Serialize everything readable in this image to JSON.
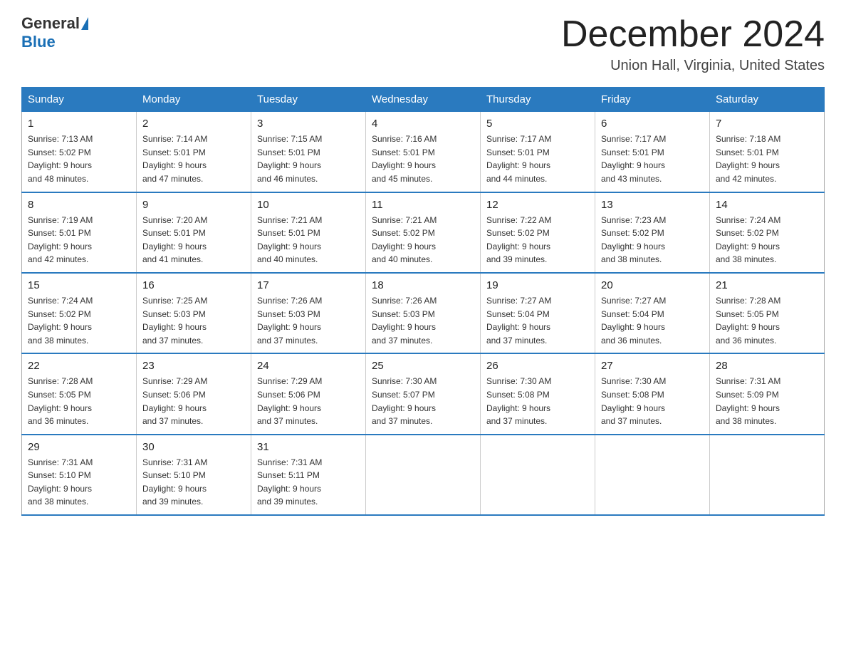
{
  "header": {
    "logo_general": "General",
    "logo_blue": "Blue",
    "month_title": "December 2024",
    "location": "Union Hall, Virginia, United States"
  },
  "days_of_week": [
    "Sunday",
    "Monday",
    "Tuesday",
    "Wednesday",
    "Thursday",
    "Friday",
    "Saturday"
  ],
  "weeks": [
    [
      {
        "day": "1",
        "sunrise": "7:13 AM",
        "sunset": "5:02 PM",
        "daylight_h": "9",
        "daylight_m": "48"
      },
      {
        "day": "2",
        "sunrise": "7:14 AM",
        "sunset": "5:01 PM",
        "daylight_h": "9",
        "daylight_m": "47"
      },
      {
        "day": "3",
        "sunrise": "7:15 AM",
        "sunset": "5:01 PM",
        "daylight_h": "9",
        "daylight_m": "46"
      },
      {
        "day": "4",
        "sunrise": "7:16 AM",
        "sunset": "5:01 PM",
        "daylight_h": "9",
        "daylight_m": "45"
      },
      {
        "day": "5",
        "sunrise": "7:17 AM",
        "sunset": "5:01 PM",
        "daylight_h": "9",
        "daylight_m": "44"
      },
      {
        "day": "6",
        "sunrise": "7:17 AM",
        "sunset": "5:01 PM",
        "daylight_h": "9",
        "daylight_m": "43"
      },
      {
        "day": "7",
        "sunrise": "7:18 AM",
        "sunset": "5:01 PM",
        "daylight_h": "9",
        "daylight_m": "42"
      }
    ],
    [
      {
        "day": "8",
        "sunrise": "7:19 AM",
        "sunset": "5:01 PM",
        "daylight_h": "9",
        "daylight_m": "42"
      },
      {
        "day": "9",
        "sunrise": "7:20 AM",
        "sunset": "5:01 PM",
        "daylight_h": "9",
        "daylight_m": "41"
      },
      {
        "day": "10",
        "sunrise": "7:21 AM",
        "sunset": "5:01 PM",
        "daylight_h": "9",
        "daylight_m": "40"
      },
      {
        "day": "11",
        "sunrise": "7:21 AM",
        "sunset": "5:02 PM",
        "daylight_h": "9",
        "daylight_m": "40"
      },
      {
        "day": "12",
        "sunrise": "7:22 AM",
        "sunset": "5:02 PM",
        "daylight_h": "9",
        "daylight_m": "39"
      },
      {
        "day": "13",
        "sunrise": "7:23 AM",
        "sunset": "5:02 PM",
        "daylight_h": "9",
        "daylight_m": "38"
      },
      {
        "day": "14",
        "sunrise": "7:24 AM",
        "sunset": "5:02 PM",
        "daylight_h": "9",
        "daylight_m": "38"
      }
    ],
    [
      {
        "day": "15",
        "sunrise": "7:24 AM",
        "sunset": "5:02 PM",
        "daylight_h": "9",
        "daylight_m": "38"
      },
      {
        "day": "16",
        "sunrise": "7:25 AM",
        "sunset": "5:03 PM",
        "daylight_h": "9",
        "daylight_m": "37"
      },
      {
        "day": "17",
        "sunrise": "7:26 AM",
        "sunset": "5:03 PM",
        "daylight_h": "9",
        "daylight_m": "37"
      },
      {
        "day": "18",
        "sunrise": "7:26 AM",
        "sunset": "5:03 PM",
        "daylight_h": "9",
        "daylight_m": "37"
      },
      {
        "day": "19",
        "sunrise": "7:27 AM",
        "sunset": "5:04 PM",
        "daylight_h": "9",
        "daylight_m": "37"
      },
      {
        "day": "20",
        "sunrise": "7:27 AM",
        "sunset": "5:04 PM",
        "daylight_h": "9",
        "daylight_m": "36"
      },
      {
        "day": "21",
        "sunrise": "7:28 AM",
        "sunset": "5:05 PM",
        "daylight_h": "9",
        "daylight_m": "36"
      }
    ],
    [
      {
        "day": "22",
        "sunrise": "7:28 AM",
        "sunset": "5:05 PM",
        "daylight_h": "9",
        "daylight_m": "36"
      },
      {
        "day": "23",
        "sunrise": "7:29 AM",
        "sunset": "5:06 PM",
        "daylight_h": "9",
        "daylight_m": "37"
      },
      {
        "day": "24",
        "sunrise": "7:29 AM",
        "sunset": "5:06 PM",
        "daylight_h": "9",
        "daylight_m": "37"
      },
      {
        "day": "25",
        "sunrise": "7:30 AM",
        "sunset": "5:07 PM",
        "daylight_h": "9",
        "daylight_m": "37"
      },
      {
        "day": "26",
        "sunrise": "7:30 AM",
        "sunset": "5:08 PM",
        "daylight_h": "9",
        "daylight_m": "37"
      },
      {
        "day": "27",
        "sunrise": "7:30 AM",
        "sunset": "5:08 PM",
        "daylight_h": "9",
        "daylight_m": "37"
      },
      {
        "day": "28",
        "sunrise": "7:31 AM",
        "sunset": "5:09 PM",
        "daylight_h": "9",
        "daylight_m": "38"
      }
    ],
    [
      {
        "day": "29",
        "sunrise": "7:31 AM",
        "sunset": "5:10 PM",
        "daylight_h": "9",
        "daylight_m": "38"
      },
      {
        "day": "30",
        "sunrise": "7:31 AM",
        "sunset": "5:10 PM",
        "daylight_h": "9",
        "daylight_m": "39"
      },
      {
        "day": "31",
        "sunrise": "7:31 AM",
        "sunset": "5:11 PM",
        "daylight_h": "9",
        "daylight_m": "39"
      },
      null,
      null,
      null,
      null
    ]
  ],
  "labels": {
    "sunrise": "Sunrise:",
    "sunset": "Sunset:",
    "daylight": "Daylight: {h} hours and {m} minutes."
  }
}
